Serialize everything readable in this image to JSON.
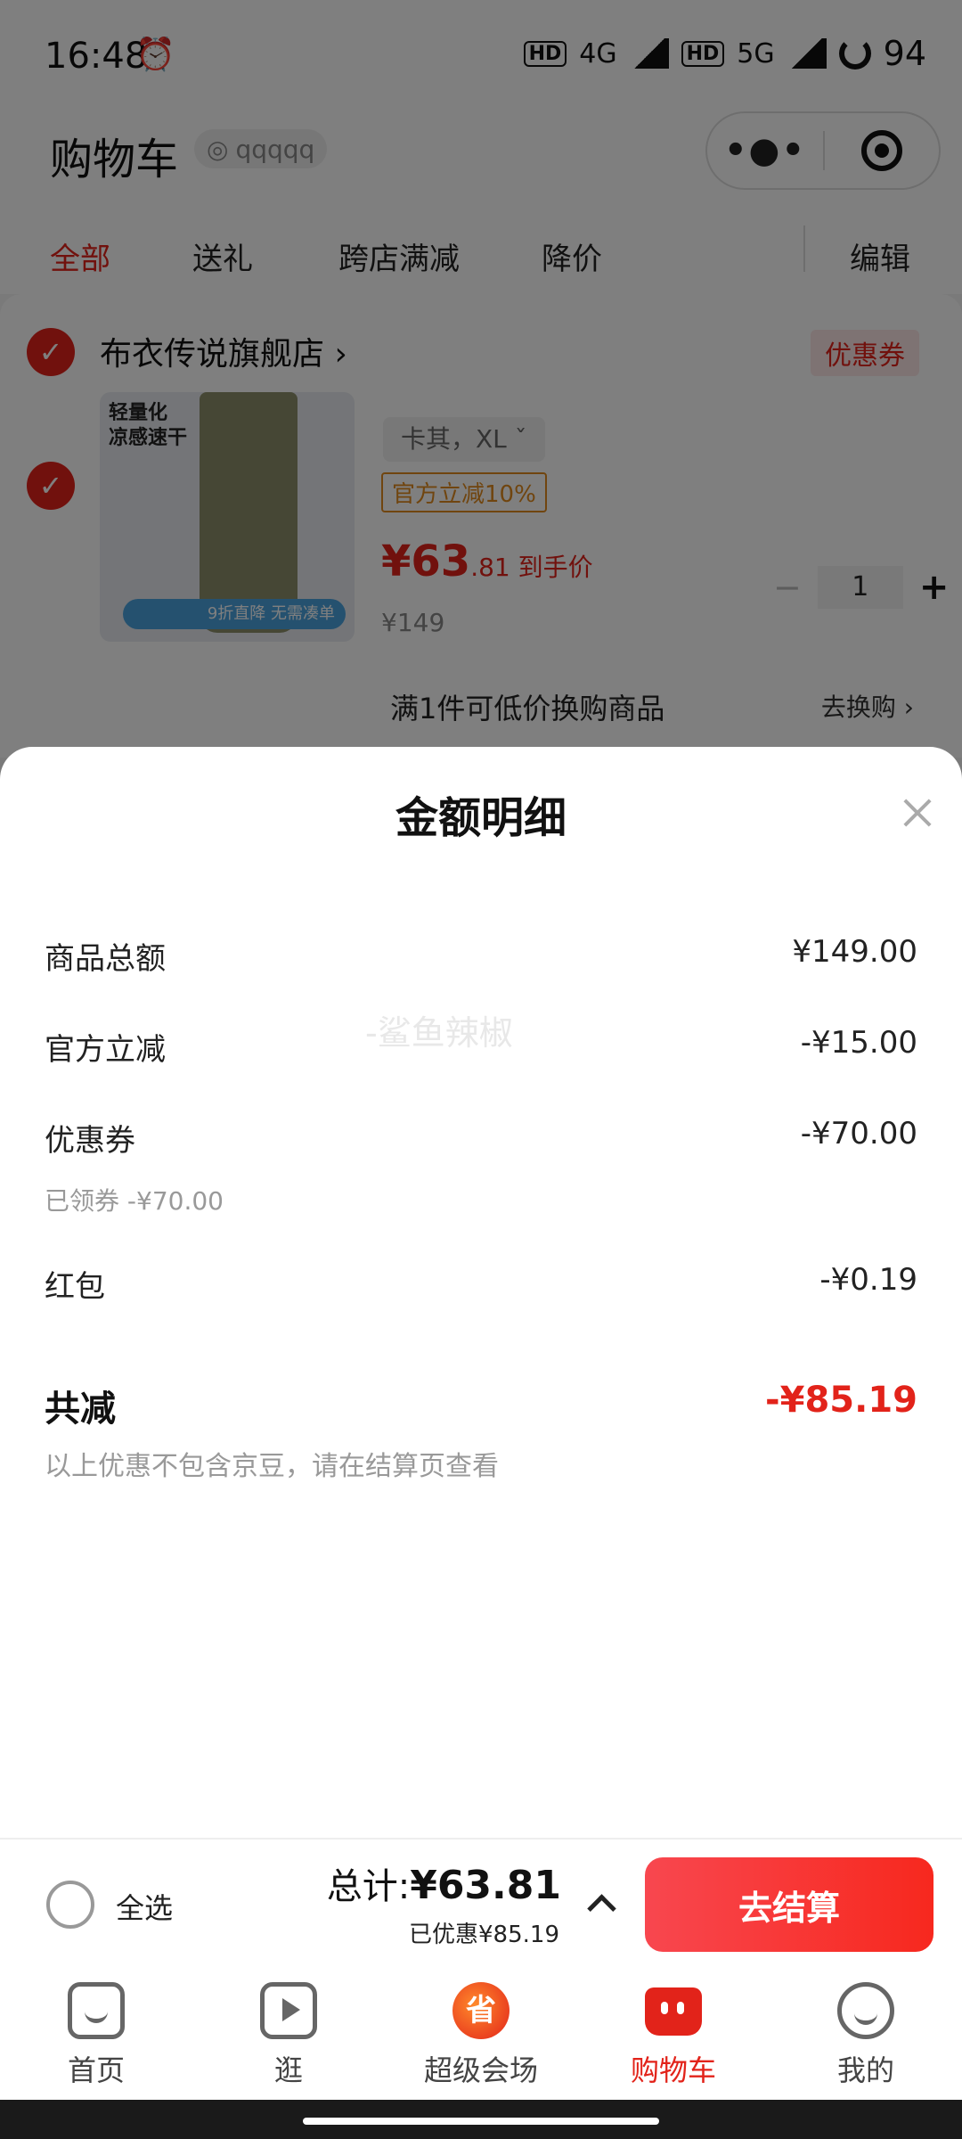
{
  "status_bar": {
    "time": "16:48",
    "network_1": "4G",
    "network_2": "5G",
    "battery": "94"
  },
  "header": {
    "title": "购物车",
    "address": "qqqqq"
  },
  "tabs": [
    {
      "label": "全部",
      "active": true
    },
    {
      "label": "送礼"
    },
    {
      "label": "跨店满减"
    },
    {
      "label": "降价"
    }
  ],
  "tabs_edit": "编辑",
  "cart": {
    "store_name": "布衣传说旗舰店 ›",
    "coupon_tag": "优惠券",
    "product": {
      "image_text": "轻量化\n凉感速干",
      "image_badge": "9折直降 无需凑单",
      "variant": "卡其，XL ˇ",
      "promo_tag": "官方立减10%",
      "price_big": "¥63",
      "price_small": ".81 到手价",
      "price_original": "¥149",
      "quantity": "1"
    },
    "exchange_text": "满1件可低价换购商品",
    "exchange_link": "去换购 ›"
  },
  "sheet": {
    "title": "金额明细",
    "watermark": "-鲨鱼辣椒",
    "rows": [
      {
        "label": "商品总额",
        "value": "¥149.00"
      },
      {
        "label": "官方立减",
        "value": "-¥15.00"
      },
      {
        "label": "优惠券",
        "value": "-¥70.00",
        "sub": "已领券 -¥70.00"
      },
      {
        "label": "红包",
        "value": "-¥0.19"
      }
    ],
    "total_label": "共减",
    "total_value": "-¥85.19",
    "total_note": "以上优惠不包含京豆，请在结算页查看"
  },
  "checkout": {
    "select_all": "全选",
    "total_prefix": "总计:",
    "total_amount": "¥63.81",
    "saved": "已优惠¥85.19",
    "pay_button": "去结算"
  },
  "tabbar": [
    {
      "label": "首页",
      "icon": "home-icon"
    },
    {
      "label": "逛",
      "icon": "play-icon"
    },
    {
      "label": "超级会场",
      "icon": "sale-icon",
      "glyph": "省"
    },
    {
      "label": "购物车",
      "icon": "cart-icon",
      "active": true
    },
    {
      "label": "我的",
      "icon": "face-icon"
    }
  ],
  "colors": {
    "accent": "#e2231a",
    "pay_gradient_start": "#f8474f",
    "pay_gradient_end": "#f7281e"
  }
}
